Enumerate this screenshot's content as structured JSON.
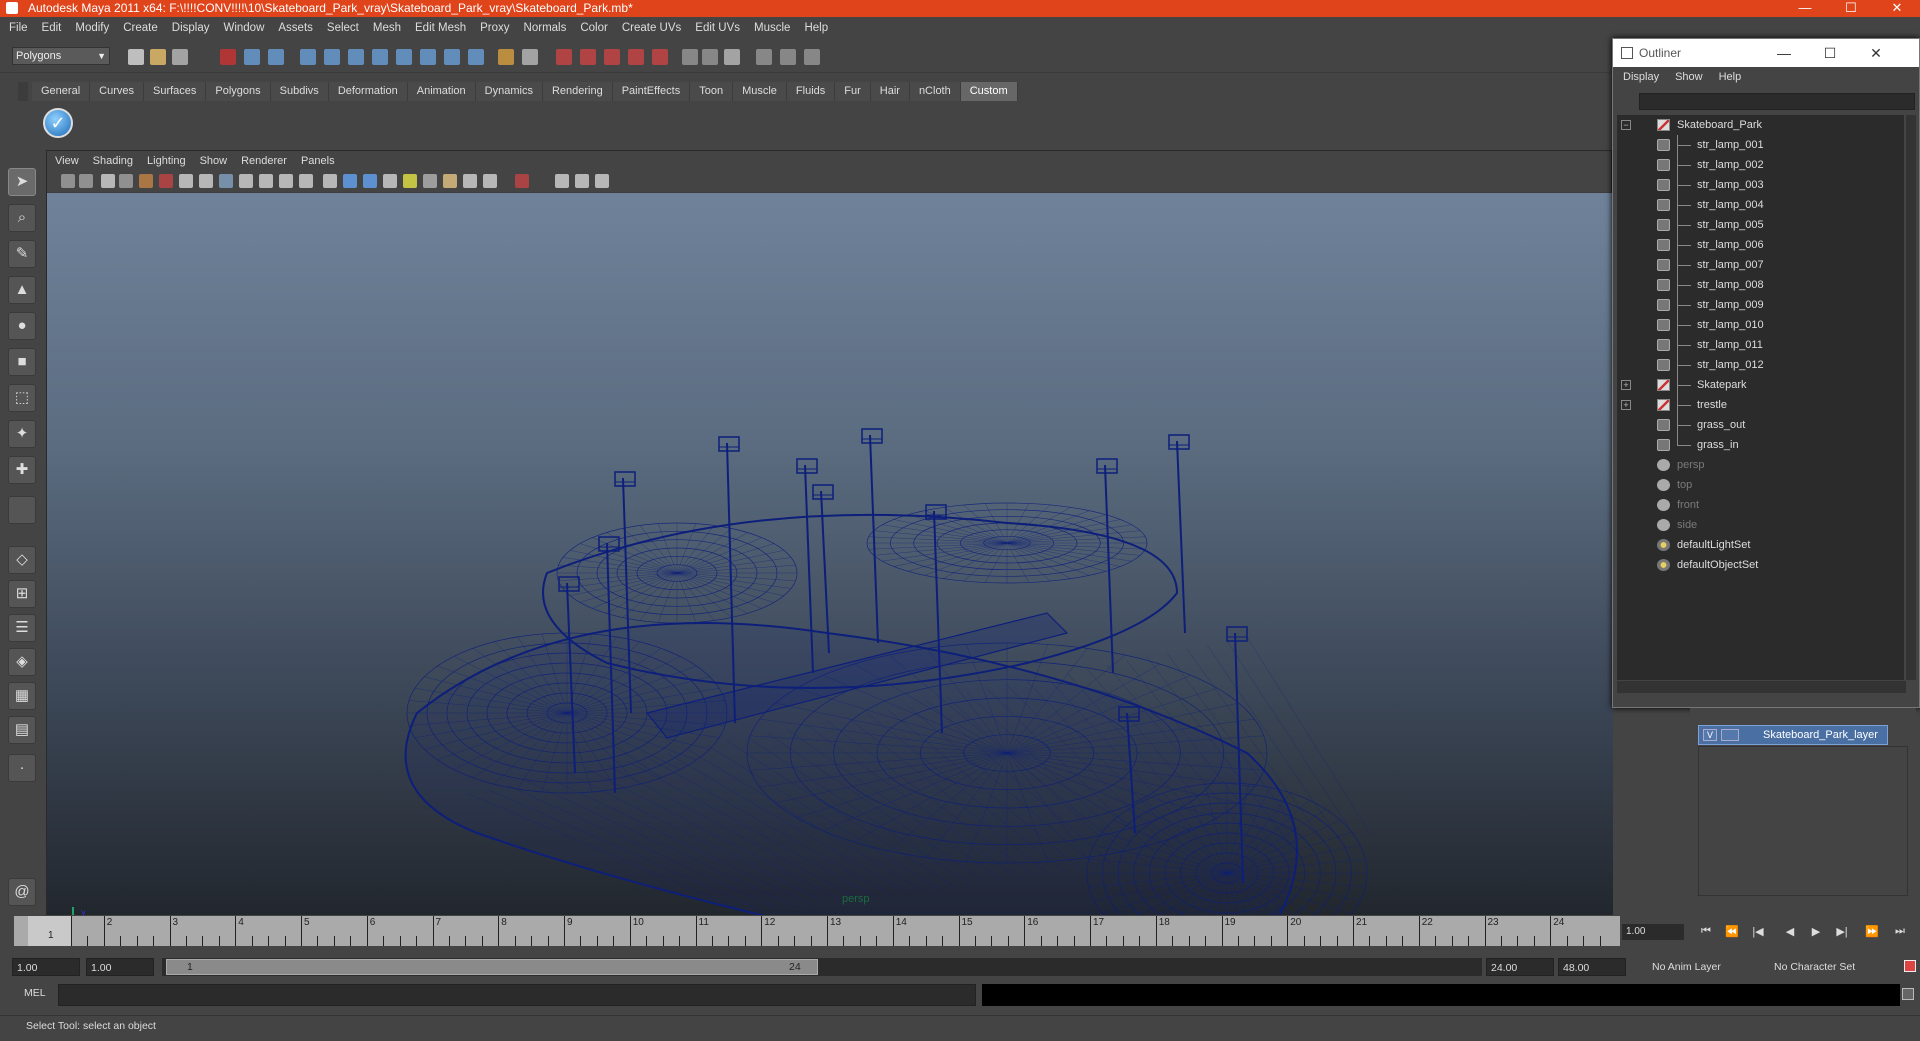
{
  "window": {
    "title": "Autodesk Maya 2011 x64: F:\\!!!!CONV!!!!\\10\\Skateboard_Park_vray\\Skateboard_Park_vray\\Skateboard_Park.mb*"
  },
  "menubar": [
    "File",
    "Edit",
    "Modify",
    "Create",
    "Display",
    "Window",
    "Assets",
    "Select",
    "Mesh",
    "Edit Mesh",
    "Proxy",
    "Normals",
    "Color",
    "Create UVs",
    "Edit UVs",
    "Muscle",
    "Help"
  ],
  "statusline": {
    "mode": "Polygons"
  },
  "shelf": {
    "tabs": [
      "General",
      "Curves",
      "Surfaces",
      "Polygons",
      "Subdivs",
      "Deformation",
      "Animation",
      "Dynamics",
      "Rendering",
      "PaintEffects",
      "Toon",
      "Muscle",
      "Fluids",
      "Fur",
      "Hair",
      "nCloth",
      "Custom"
    ],
    "active_tab": "Custom"
  },
  "viewport": {
    "menu": [
      "View",
      "Shading",
      "Lighting",
      "Show",
      "Renderer",
      "Panels"
    ],
    "camera": "persp",
    "wire_color": "#0d1f7a"
  },
  "outliner": {
    "title": "Outliner",
    "menu": [
      "Display",
      "Show",
      "Help"
    ],
    "items": [
      {
        "label": "Skateboard_Park",
        "type": "group",
        "depth": 0,
        "expander": "−"
      },
      {
        "label": "str_lamp_001",
        "type": "mesh",
        "depth": 1
      },
      {
        "label": "str_lamp_002",
        "type": "mesh",
        "depth": 1
      },
      {
        "label": "str_lamp_003",
        "type": "mesh",
        "depth": 1
      },
      {
        "label": "str_lamp_004",
        "type": "mesh",
        "depth": 1
      },
      {
        "label": "str_lamp_005",
        "type": "mesh",
        "depth": 1
      },
      {
        "label": "str_lamp_006",
        "type": "mesh",
        "depth": 1
      },
      {
        "label": "str_lamp_007",
        "type": "mesh",
        "depth": 1
      },
      {
        "label": "str_lamp_008",
        "type": "mesh",
        "depth": 1
      },
      {
        "label": "str_lamp_009",
        "type": "mesh",
        "depth": 1
      },
      {
        "label": "str_lamp_010",
        "type": "mesh",
        "depth": 1
      },
      {
        "label": "str_lamp_011",
        "type": "mesh",
        "depth": 1
      },
      {
        "label": "str_lamp_012",
        "type": "mesh",
        "depth": 1
      },
      {
        "label": "Skatepark",
        "type": "group",
        "depth": 1,
        "expander": "+"
      },
      {
        "label": "trestle",
        "type": "group",
        "depth": 1,
        "expander": "+"
      },
      {
        "label": "grass_out",
        "type": "mesh",
        "depth": 1
      },
      {
        "label": "grass_in",
        "type": "mesh",
        "depth": 1
      },
      {
        "label": "persp",
        "type": "camera",
        "depth": 0,
        "dim": true
      },
      {
        "label": "top",
        "type": "camera",
        "depth": 0,
        "dim": true
      },
      {
        "label": "front",
        "type": "camera",
        "depth": 0,
        "dim": true
      },
      {
        "label": "side",
        "type": "camera",
        "depth": 0,
        "dim": true
      },
      {
        "label": "defaultLightSet",
        "type": "set",
        "depth": 0
      },
      {
        "label": "defaultObjectSet",
        "type": "set",
        "depth": 0
      }
    ]
  },
  "layers": {
    "layer_name": "Skateboard_Park_layer",
    "visible_flag": "V"
  },
  "timeline": {
    "ticks": [
      "1",
      "2",
      "3",
      "4",
      "5",
      "6",
      "7",
      "8",
      "9",
      "10",
      "11",
      "12",
      "13",
      "14",
      "15",
      "16",
      "17",
      "18",
      "19",
      "20",
      "21",
      "22",
      "23",
      "24"
    ],
    "current_frame": "1",
    "current_time": "1.00"
  },
  "range": {
    "start": "1.00",
    "playback_start": "1.00",
    "thumb_start": "1",
    "thumb_end": "24",
    "playback_end": "24.00",
    "end": "48.00",
    "anim_layer": "No Anim Layer",
    "character_set": "No Character Set"
  },
  "cmdline": {
    "label": "MEL"
  },
  "helpline": {
    "text": "Select Tool: select an object"
  }
}
